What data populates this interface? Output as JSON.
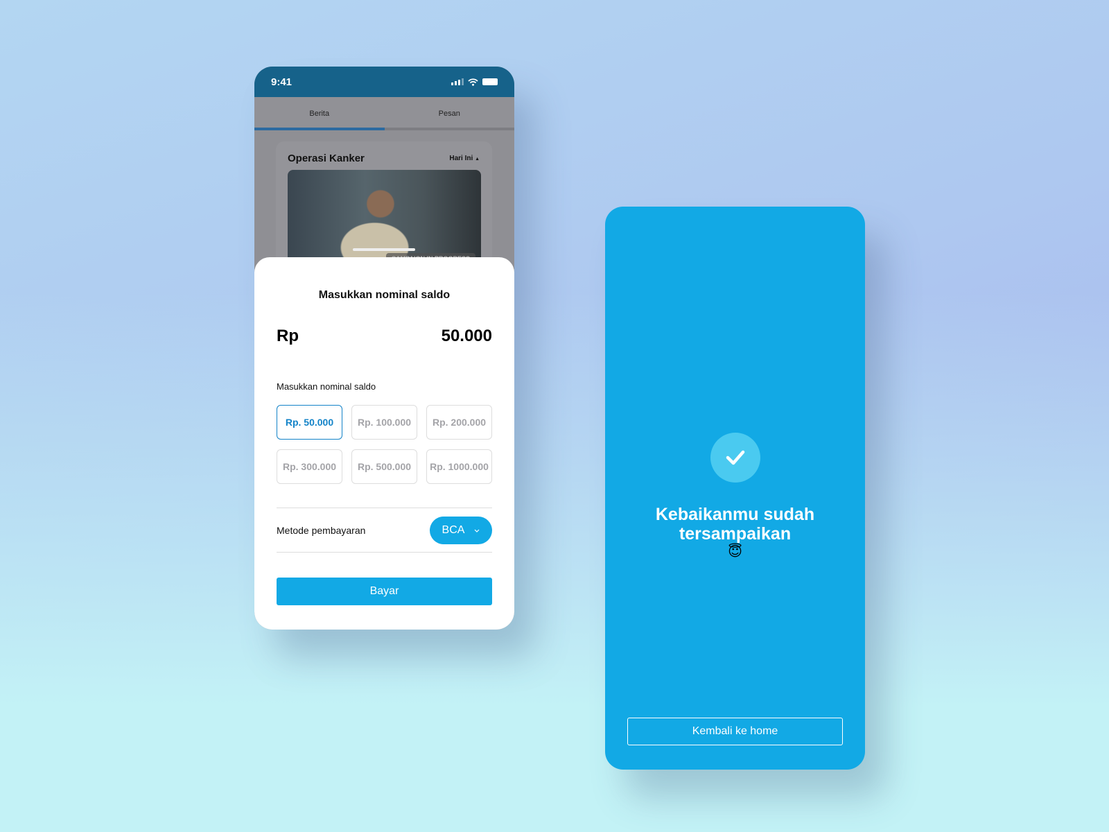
{
  "colors": {
    "accent": "#12a9e5",
    "selected": "#1383c8",
    "status_bar": "#16628a"
  },
  "donation_screen": {
    "status": {
      "time": "9:41",
      "icons": [
        "signal-icon",
        "wifi-icon",
        "battery-icon"
      ]
    },
    "tabs": [
      {
        "label": "Berita",
        "active": true
      },
      {
        "label": "Pesan",
        "active": false
      }
    ],
    "card": {
      "title": "Operasi Kanker",
      "date_filter": "Hari Ini",
      "badge": "CAMPAIGN IN PROGRESS"
    },
    "sheet": {
      "title": "Masukkan nominal saldo",
      "currency": "Rp",
      "amount": "50.000",
      "options_label": "Masukkan nominal saldo",
      "options": [
        {
          "label": "Rp. 50.000",
          "selected": true
        },
        {
          "label": "Rp. 100.000"
        },
        {
          "label": "Rp. 200.000"
        },
        {
          "label": "Rp. 300.000"
        },
        {
          "label": "Rp. 500.000"
        },
        {
          "label": "Rp. 1000.000"
        }
      ],
      "method_label": "Metode pembayaran",
      "method_value": "BCA",
      "pay_label": "Bayar"
    }
  },
  "success_screen": {
    "line1": "Kebaikanmu sudah",
    "line2": "tersampaikan",
    "emoji": "😇",
    "home_label": "Kembali ke home"
  }
}
